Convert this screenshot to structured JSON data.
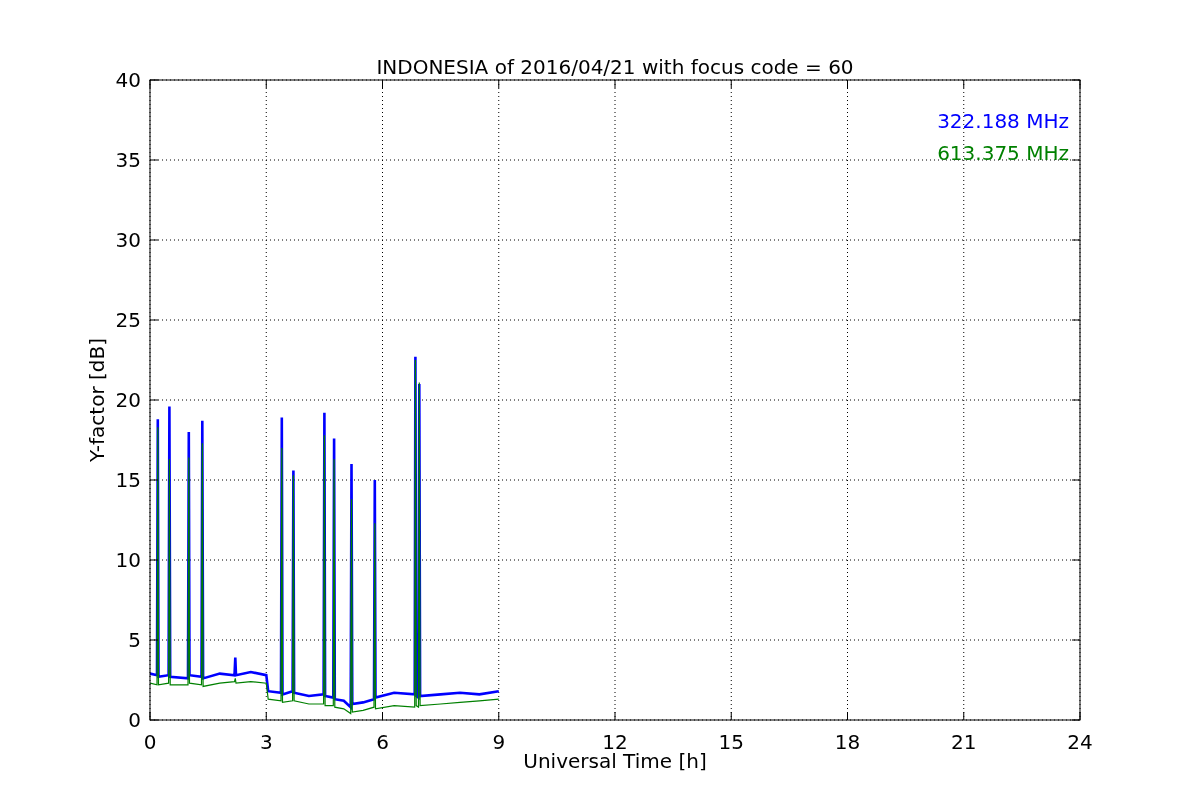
{
  "figure": {
    "chart_data": {
      "type": "line",
      "title": "INDONESIA of 2016/04/21 with focus code = 60",
      "xlabel": "Universal Time [h]",
      "ylabel": "Y-factor [dB]",
      "x": [
        0,
        0.18,
        0.2,
        0.22,
        0.48,
        0.5,
        0.52,
        0.98,
        1.0,
        1.02,
        1.33,
        1.35,
        1.37,
        1.8,
        2.18,
        2.2,
        2.22,
        2.6,
        3.0,
        3.05,
        3.38,
        3.4,
        3.42,
        3.68,
        3.7,
        3.72,
        4.1,
        4.48,
        4.5,
        4.52,
        4.73,
        4.75,
        4.77,
        5.0,
        5.18,
        5.2,
        5.22,
        5.5,
        5.78,
        5.8,
        5.82,
        6.3,
        6.83,
        6.85,
        6.87,
        6.93,
        6.95,
        6.97,
        7.5,
        8.0,
        8.5,
        9.0
      ],
      "series": [
        {
          "name": "322.188 MHz",
          "color": "#0000ff",
          "values": [
            2.9,
            2.8,
            18.8,
            2.7,
            2.8,
            19.6,
            2.7,
            2.6,
            18.0,
            2.8,
            2.7,
            18.7,
            2.6,
            2.9,
            2.8,
            3.9,
            2.8,
            3.0,
            2.8,
            1.8,
            1.7,
            18.9,
            1.6,
            1.8,
            15.6,
            1.7,
            1.5,
            1.6,
            19.2,
            1.5,
            1.4,
            17.6,
            1.3,
            1.2,
            0.8,
            16.0,
            1.0,
            1.1,
            1.3,
            15.0,
            1.4,
            1.7,
            1.6,
            22.7,
            1.5,
            1.4,
            21.0,
            1.5,
            1.6,
            1.7,
            1.6,
            1.8
          ]
        },
        {
          "name": "613.375 MHz",
          "color": "#008000",
          "values": [
            2.3,
            2.2,
            18.3,
            2.2,
            2.3,
            16.3,
            2.2,
            2.2,
            16.4,
            2.3,
            2.2,
            17.3,
            2.1,
            2.3,
            2.4,
            2.6,
            2.3,
            2.4,
            2.3,
            1.3,
            1.2,
            17.0,
            1.1,
            1.2,
            15.3,
            1.2,
            1.0,
            1.0,
            17.8,
            0.9,
            0.9,
            16.3,
            0.8,
            0.7,
            0.4,
            13.8,
            0.5,
            0.6,
            0.8,
            12.3,
            0.7,
            0.9,
            0.8,
            22.5,
            0.9,
            0.8,
            21.1,
            0.9,
            1.0,
            1.1,
            1.2,
            1.3
          ]
        }
      ],
      "grid": true,
      "xlim": [
        0,
        24
      ],
      "ylim": [
        0,
        40
      ],
      "xticks": [
        0,
        3,
        6,
        9,
        12,
        15,
        18,
        21,
        24
      ],
      "yticks": [
        0,
        5,
        10,
        15,
        20,
        25,
        30,
        35,
        40
      ]
    }
  }
}
